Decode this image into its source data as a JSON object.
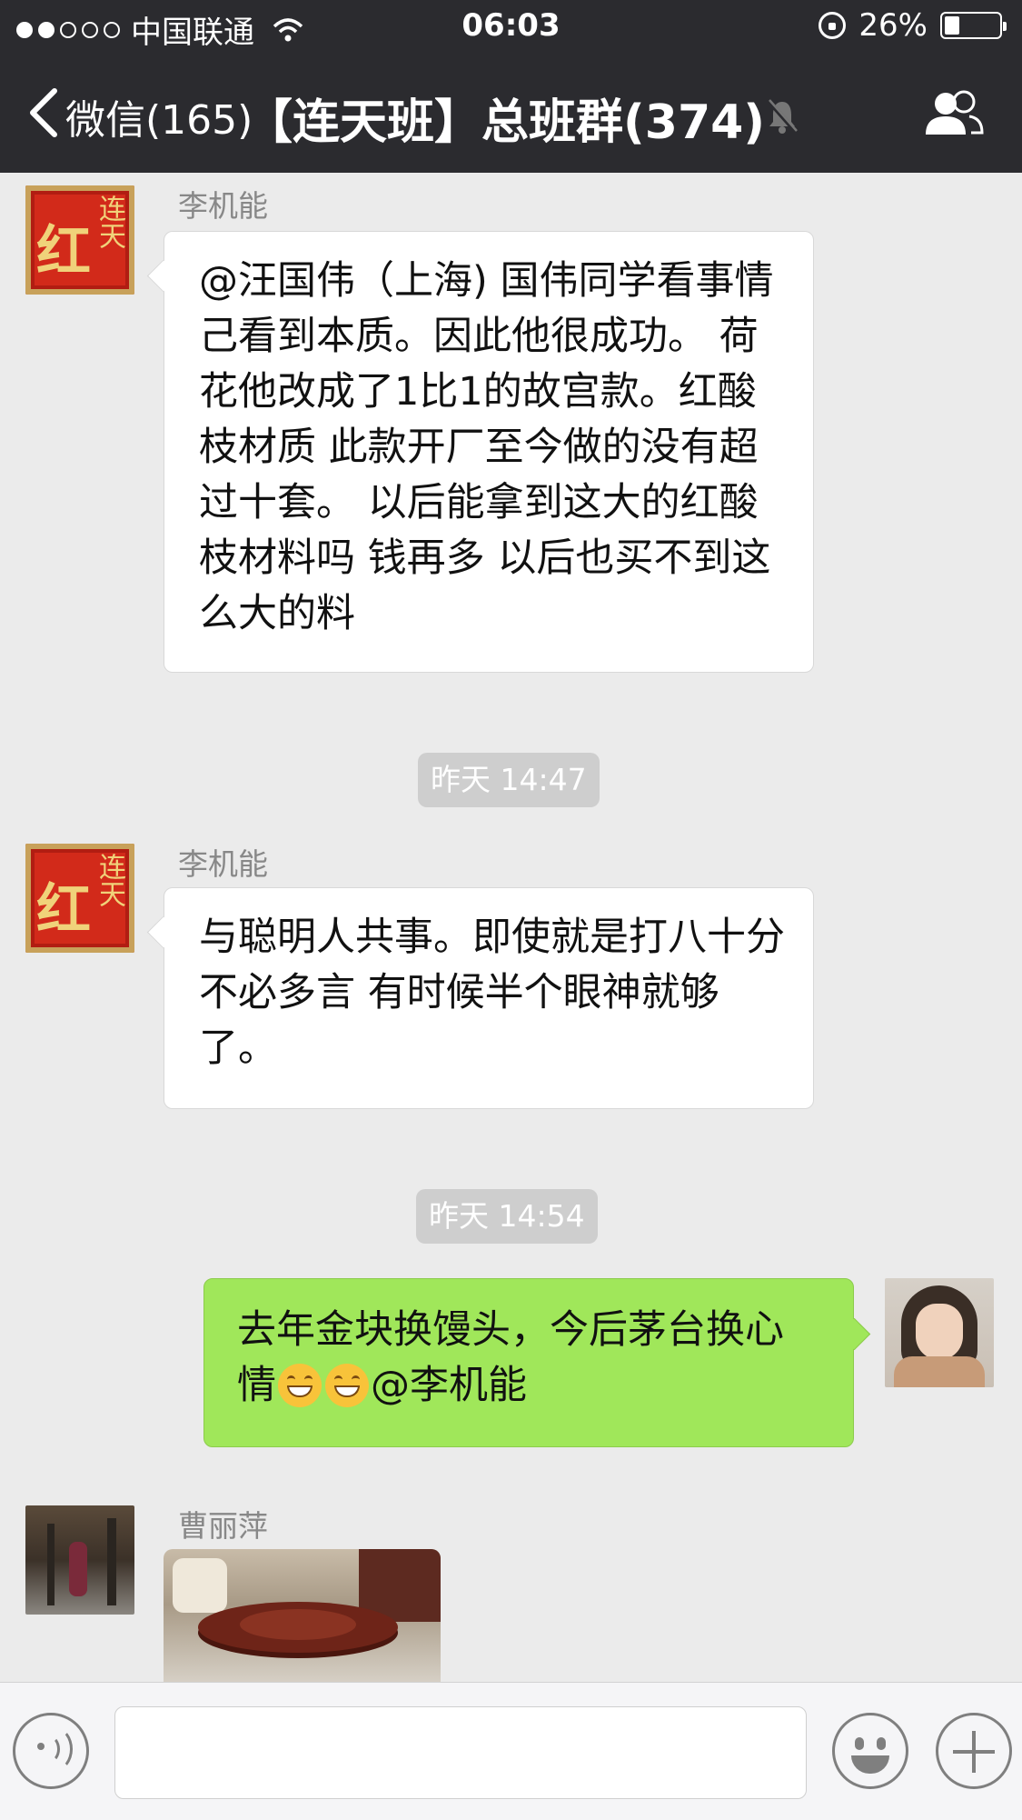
{
  "status_bar": {
    "signal_dots": [
      true,
      true,
      false,
      false,
      false
    ],
    "carrier": "中国联通",
    "time": "06:03",
    "battery_percent": "26%",
    "battery_level": 0.26
  },
  "nav": {
    "back_label": "微信(165)",
    "title": "【连天班】总班群(374)"
  },
  "messages": [
    {
      "sender": "李机能",
      "text": "@汪国伟（上海) 国伟同学看事情己看到本质。因此他很成功。 荷花他改成了1比1的故宫款。红酸枝材质  此款开厂至今做的没有超过十套。 以后能拿到这大的红酸枝材料吗   钱再多 以后也买不到这么大的料"
    },
    {
      "timestamp": "昨天 14:47"
    },
    {
      "sender": "李机能",
      "text": "与聪明人共事。即使就是打八十分   不必多言  有时候半个眼神就够了。"
    },
    {
      "timestamp": "昨天 14:54"
    },
    {
      "outgoing": true,
      "text_before": "去年金块换馒头，今后茅台换心情",
      "text_after": "@李机能"
    },
    {
      "sender": "曹丽萍",
      "image": true
    }
  ],
  "input": {
    "placeholder": ""
  },
  "avatar_seal": {
    "main": "红",
    "side": "连天"
  }
}
